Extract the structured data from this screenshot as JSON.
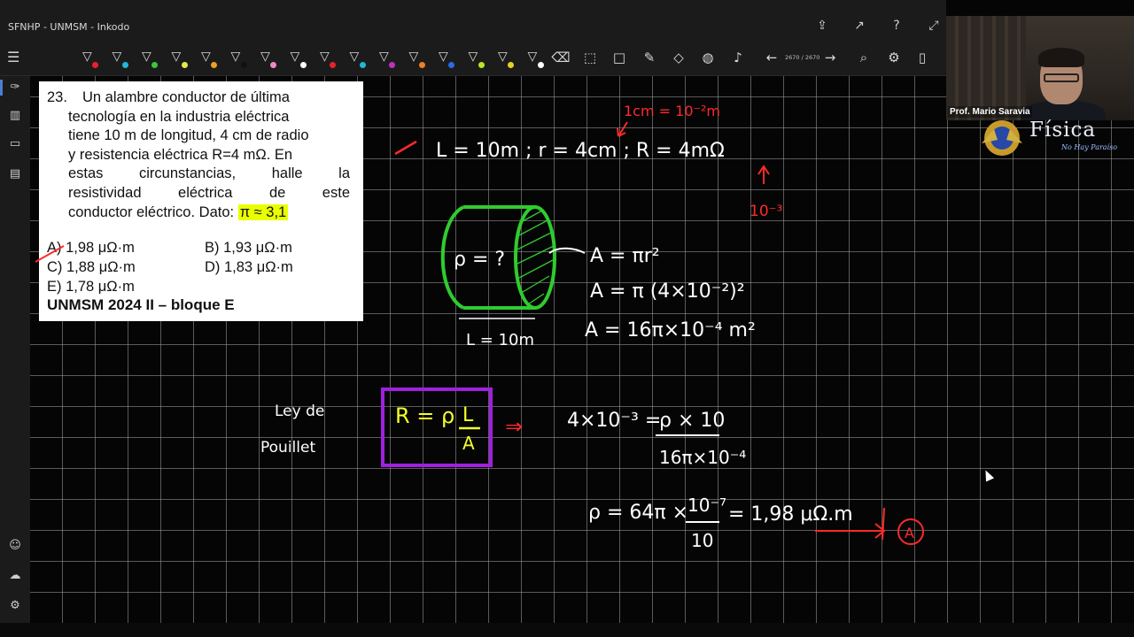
{
  "window": {
    "title": "SFNHP - UNMSM - Inkodo"
  },
  "titlebar": {
    "icons": [
      "share-icon",
      "export-icon",
      "help-icon",
      "expand-icon"
    ]
  },
  "toolbar": {
    "pens": [
      {
        "icon": "pen-icon",
        "color": "#e8222a"
      },
      {
        "icon": "pen-icon",
        "color": "#1fb8d8"
      },
      {
        "icon": "pen-icon",
        "color": "#3cc43c"
      },
      {
        "icon": "pen-icon",
        "color": "#e8e84a"
      },
      {
        "icon": "pen-icon",
        "color": "#f0a020"
      },
      {
        "icon": "pen-icon",
        "color": "#111111"
      },
      {
        "icon": "pen-icon",
        "color": "#f088c8"
      },
      {
        "icon": "pen-icon",
        "color": "#ffffff"
      },
      {
        "icon": "pen-icon",
        "color": "#e8222a"
      },
      {
        "icon": "pen-icon",
        "color": "#1fb8d8"
      },
      {
        "icon": "pen-icon",
        "color": "#c030c0"
      },
      {
        "icon": "pen-icon",
        "color": "#f08020"
      },
      {
        "icon": "pen-icon",
        "color": "#2a6ae8"
      },
      {
        "icon": "pen-icon",
        "color": "#b8e820"
      },
      {
        "icon": "pen-icon",
        "color": "#e8d020"
      },
      {
        "icon": "pen-icon",
        "color": "#ffffff"
      }
    ],
    "tools": [
      "eraser-icon",
      "lasso-icon",
      "rectangle-icon",
      "ruler-icon",
      "shape-icon",
      "palette-icon",
      "microphone-icon"
    ],
    "page_counter": "2670 / 2670",
    "right_tools": [
      "zoom-icon",
      "settings-icon",
      "document-icon"
    ]
  },
  "rail": {
    "icons": [
      "pen-mode-icon",
      "library-icon",
      "slides-icon",
      "clipboard-icon",
      "user-settings-icon",
      "cloud-icon",
      "gear-icon"
    ]
  },
  "problem": {
    "number": "23.",
    "first_line": "Un alambre conductor de última",
    "lines": [
      "tecnología en la industria eléctrica",
      "tiene 10 m de longitud, 4 cm de radio",
      "y resistencia eléctrica R=4 mΩ. En",
      "estas circunstancias, halle la",
      "resistividad eléctrica de este"
    ],
    "last_line_prefix": "conductor eléctrico. Dato:",
    "highlight": "π ≈ 3,1",
    "options": {
      "a": "A) 1,98 μΩ·m",
      "b": "B) 1,93 μΩ·m",
      "c": "C) 1,88 μΩ·m",
      "d": "D) 1,83 μΩ·m",
      "e": "E) 1,78 μΩ·m"
    },
    "source": "UNMSM 2024 II – bloque E"
  },
  "webcam": {
    "name": "Prof. Mario Saravia"
  },
  "logo": {
    "word": "Física",
    "tagline": "No Hay Paraíso"
  },
  "ink": {
    "given": "L = 10m ;  r = 4cm  ;   R = 4mΩ",
    "cm_note": "1cm = 10⁻²m",
    "milli_note": "10⁻³",
    "rho_unknown": "ρ = ?",
    "length_label": "L = 10m",
    "area_1": "A = πr²",
    "area_2": "A = π (4×10⁻²)²",
    "area_3": "A = 16π×10⁻⁴ m²",
    "law_1": "Ley de",
    "law_2": "Pouillet",
    "formula_lhs": "R = ρ",
    "formula_num": "L",
    "formula_den": "A",
    "arrow": "⇒",
    "sub_lhs": "4×10⁻³ =",
    "sub_num": "ρ × 10",
    "sub_den": "16π×10⁻⁴",
    "res_lhs": "ρ = 64π ×",
    "res_num": "10⁻⁷",
    "res_den": "10",
    "res_rhs": "= 1,98 μΩ.m",
    "answer": "A"
  }
}
